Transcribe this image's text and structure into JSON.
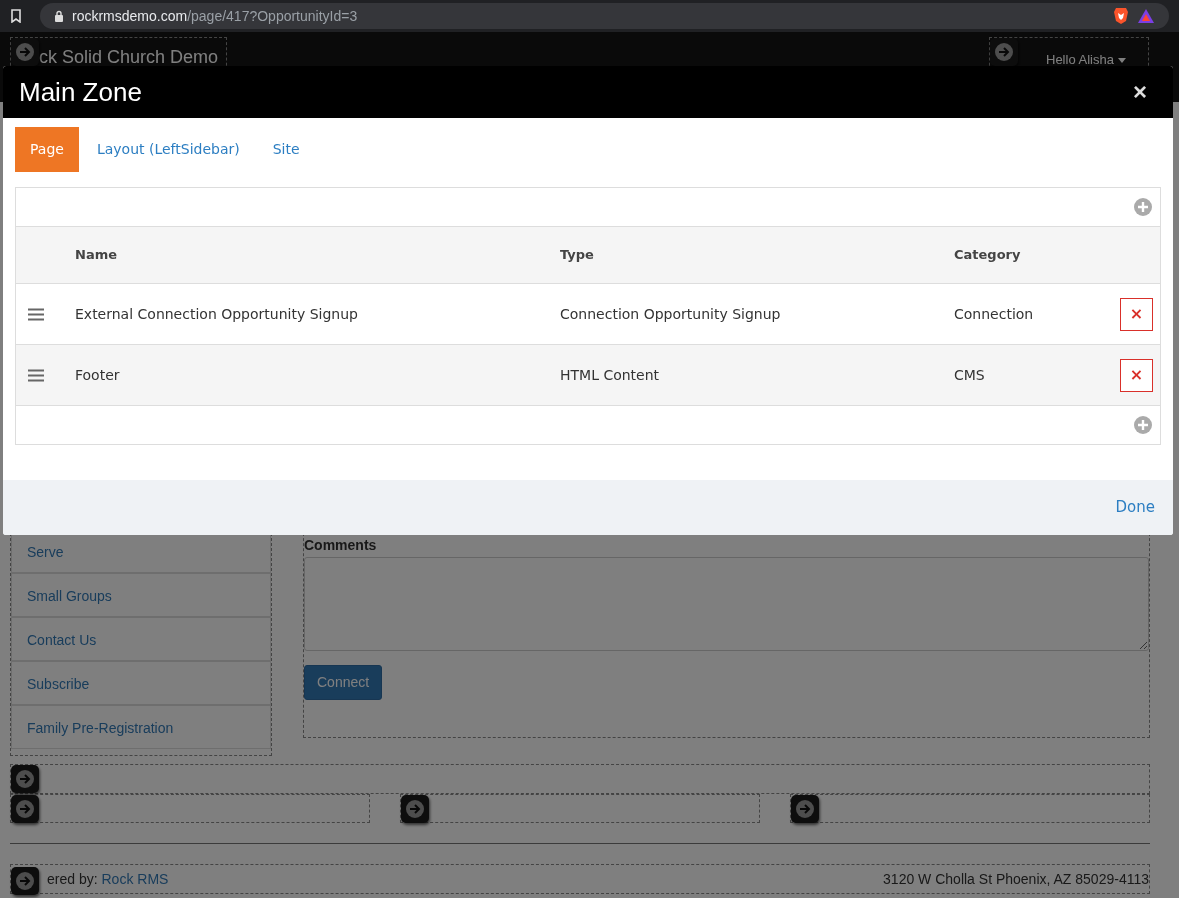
{
  "browser": {
    "url_host": "rockrmsdemo.com",
    "url_path": "/page/417?OpportunityId=3"
  },
  "site_header": {
    "title": "ck Solid Church Demo",
    "user_menu": "Hello Alisha"
  },
  "sidebar": {
    "items": [
      "Serve",
      "Small Groups",
      "Contact Us",
      "Subscribe",
      "Family Pre-Registration"
    ]
  },
  "form": {
    "comments_label": "Comments",
    "submit": "Connect"
  },
  "footer": {
    "powered_by": "ered by:",
    "link": "Rock RMS",
    "address": "3120 W Cholla St Phoenix, AZ 85029-4113"
  },
  "modal": {
    "title": "Main Zone",
    "close": "×",
    "tabs": [
      {
        "label": "Page",
        "selected": true
      },
      {
        "label": "Layout (LeftSidebar)",
        "selected": false
      },
      {
        "label": "Site",
        "selected": false
      }
    ],
    "table": {
      "columns": [
        "Name",
        "Type",
        "Category"
      ],
      "rows": [
        {
          "name": "External Connection Opportunity Signup",
          "type": "Connection Opportunity Signup",
          "category": "Connection"
        },
        {
          "name": "Footer",
          "type": "HTML Content",
          "category": "CMS"
        }
      ]
    },
    "done": "Done"
  }
}
